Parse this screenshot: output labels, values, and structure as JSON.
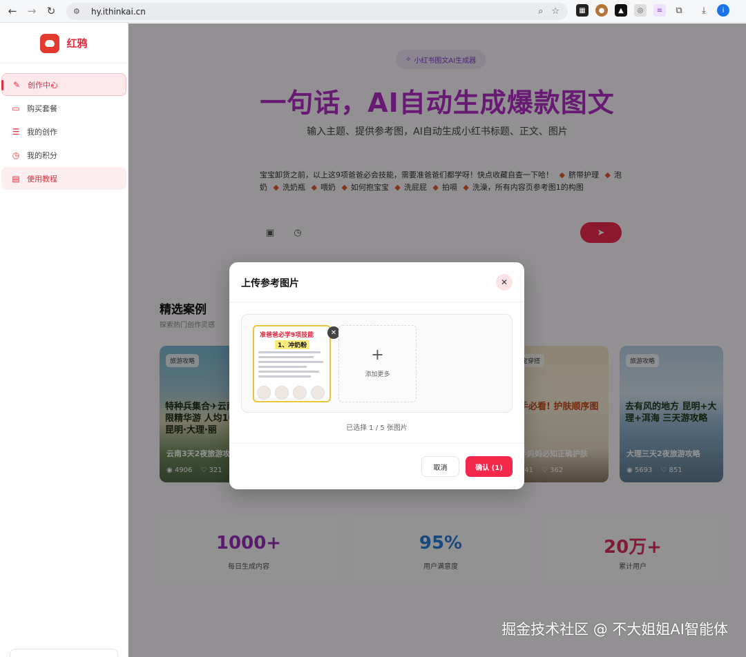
{
  "browser": {
    "url": "hy.ithinkai.cn",
    "profile_initial": "i"
  },
  "sidebar": {
    "brand": "红鸦",
    "items": [
      {
        "label": "创作中心",
        "icon": "pencil-icon"
      },
      {
        "label": "购买套餐",
        "icon": "card-icon"
      },
      {
        "label": "我的创作",
        "icon": "list-icon"
      },
      {
        "label": "我的积分",
        "icon": "clock-icon"
      },
      {
        "label": "使用教程",
        "icon": "book-icon"
      }
    ]
  },
  "hero": {
    "badge": "小红书图文AI生成器",
    "title": "一句话，AI自动生成爆款图文",
    "subtitle": "输入主题、提供参考图，AI自动生成小红书标题、正文、图片"
  },
  "prompt": {
    "intro": "宝宝卸货之前，以上这9项爸爸必会技能，需要准爸爸们都学呀！快点收藏自查一下哈！",
    "items": [
      "脐带护理",
      "泡奶",
      "洗奶瓶",
      "喂奶",
      "如何抱宝宝",
      "洗屁屁",
      "拍嗝",
      "洗澡，所有内容页参考图1的构图"
    ]
  },
  "cases": {
    "title": "精选案例",
    "subtitle": "探索热门创作灵感",
    "items": [
      {
        "tag": "旅游攻略",
        "headline": "特种兵集合✈云南 夜极限精华游 人均1000+ 昆明·大理·丽",
        "title": "云南3天2夜旅游攻略",
        "views": "4906",
        "likes": "321"
      },
      {
        "tag": "宝宝穿搭",
        "headline": "新手必看! 护肤顺序图鉴",
        "title": "新手妈妈必知正确护肤",
        "views": "241",
        "likes": "362"
      },
      {
        "tag": "旅游攻略",
        "headline": "去有风的地方 昆明+大理+洱海 三天游攻略",
        "title": "大理三天2夜旅游攻略",
        "views": "5693",
        "likes": "851"
      }
    ]
  },
  "stats": [
    {
      "value": "1000+",
      "label": "每日生成内容",
      "color": "#9b2fc0"
    },
    {
      "value": "95%",
      "label": "用户满意度",
      "color": "#2a7fd6"
    },
    {
      "value": "20万+",
      "label": "累计用户",
      "color": "#d9305e"
    }
  ],
  "modal": {
    "title": "上传参考图片",
    "thumb_title": "准爸爸必学9项技能",
    "thumb_subtitle": "1、冲奶粉",
    "add_more": "添加更多",
    "selected": "已选择 1 / 5 张图片",
    "cancel": "取消",
    "confirm": "确认 (1)"
  },
  "watermark": "掘金技术社区 @ 不大姐姐AI智能体"
}
